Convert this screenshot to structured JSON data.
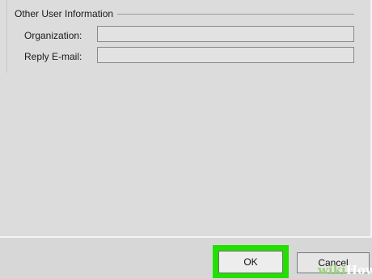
{
  "group": {
    "title": "Other User Information"
  },
  "fields": [
    {
      "label": "Organization:",
      "value": "",
      "placeholder": ""
    },
    {
      "label": "Reply E-mail:",
      "value": "",
      "placeholder": ""
    }
  ],
  "buttons": {
    "ok_label": "OK",
    "cancel_label": "Cancel"
  },
  "watermark": {
    "part1": "wiki",
    "part2": "How"
  },
  "colors": {
    "highlight": "#22e000",
    "dialog_background": "#dcdcdc"
  }
}
